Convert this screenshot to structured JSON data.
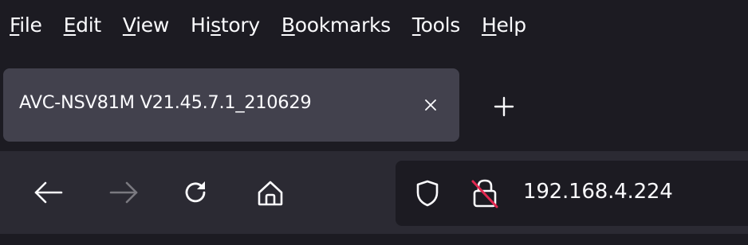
{
  "menu": {
    "items": [
      {
        "accel": "F",
        "rest": "ile"
      },
      {
        "accel": "E",
        "rest": "dit"
      },
      {
        "accel": "V",
        "rest": "iew"
      },
      {
        "pre": "Hi",
        "accel": "s",
        "rest": "tory"
      },
      {
        "accel": "B",
        "rest": "ookmarks"
      },
      {
        "accel": "T",
        "rest": "ools"
      },
      {
        "accel": "H",
        "rest": "elp"
      }
    ]
  },
  "tab": {
    "title": "AVC-NSV81M V21.45.7.1_210629",
    "close_icon": "close-icon"
  },
  "newtab": {
    "icon": "plus-icon"
  },
  "nav": {
    "back_icon": "back-arrow-icon",
    "forward_icon": "forward-arrow-icon",
    "reload_icon": "reload-icon",
    "home_icon": "home-icon"
  },
  "urlbar": {
    "url": "192.168.4.224",
    "shield_icon": "shield-icon",
    "lock_icon": "insecure-lock-icon"
  },
  "colors": {
    "menubar_bg": "#1c1b22",
    "tab_bg": "#42414d",
    "toolbar_bg": "#2b2a33",
    "urlbar_bg": "#1c1b22",
    "text": "#fbfbfe",
    "insecure_slash": "#e22850"
  }
}
